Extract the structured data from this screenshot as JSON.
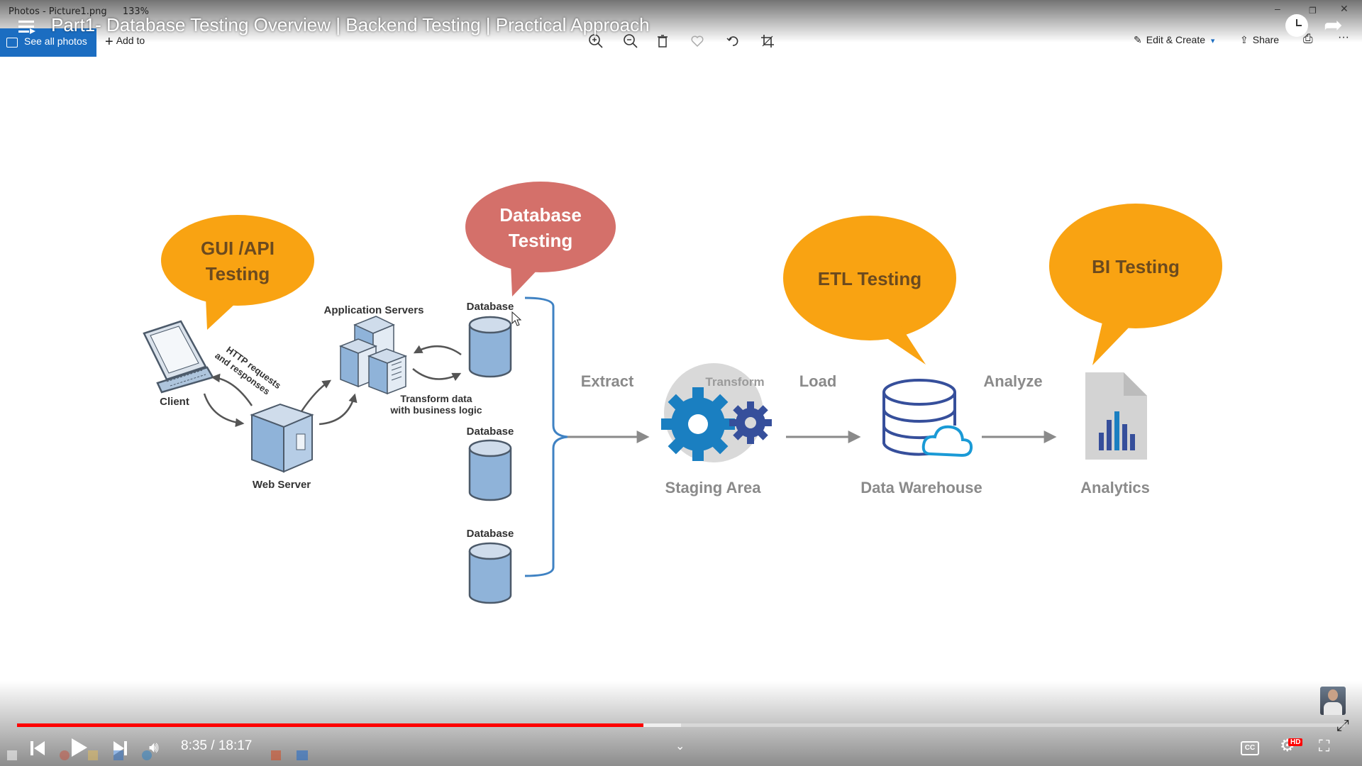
{
  "photos_app": {
    "window_title": "Photos - Picture1.png",
    "zoom": "133%",
    "see_all_label": "See all photos",
    "add_to_label": "Add to",
    "edit_create_label": "Edit & Create",
    "share_label": "Share"
  },
  "video": {
    "title": "Part1- Database Testing Overview | Backend Testing | Practical Approach",
    "current_time": "8:35",
    "duration": "18:17",
    "time_display": "8:35 / 18:17",
    "progress": 0.4716,
    "buffered": 0.5,
    "hd_badge": "HD"
  },
  "slide": {
    "bubbles": {
      "gui_api": [
        "GUI /API",
        "Testing"
      ],
      "database": [
        "Database",
        "Testing"
      ],
      "etl": "ETL Testing",
      "bi": "BI Testing"
    },
    "labels": {
      "client": "Client",
      "web_server": "Web Server",
      "app_servers": "Application Servers",
      "http_1": "HTTP requests",
      "http_2": "and responses",
      "transform_1": "Transform data",
      "transform_2": "with business logic",
      "database": "Database",
      "extract": "Extract",
      "transform": "Transform",
      "load": "Load",
      "analyze": "Analyze",
      "staging": "Staging Area",
      "warehouse": "Data Warehouse",
      "analytics": "Analytics"
    }
  },
  "colors": {
    "orange": "#f9a312",
    "salmon": "#d4706a",
    "db_blue": "#8fb3d9",
    "gear_blue": "#1a7fc1",
    "warehouse_blue": "#364f9b",
    "yt_red": "#ff0000"
  }
}
